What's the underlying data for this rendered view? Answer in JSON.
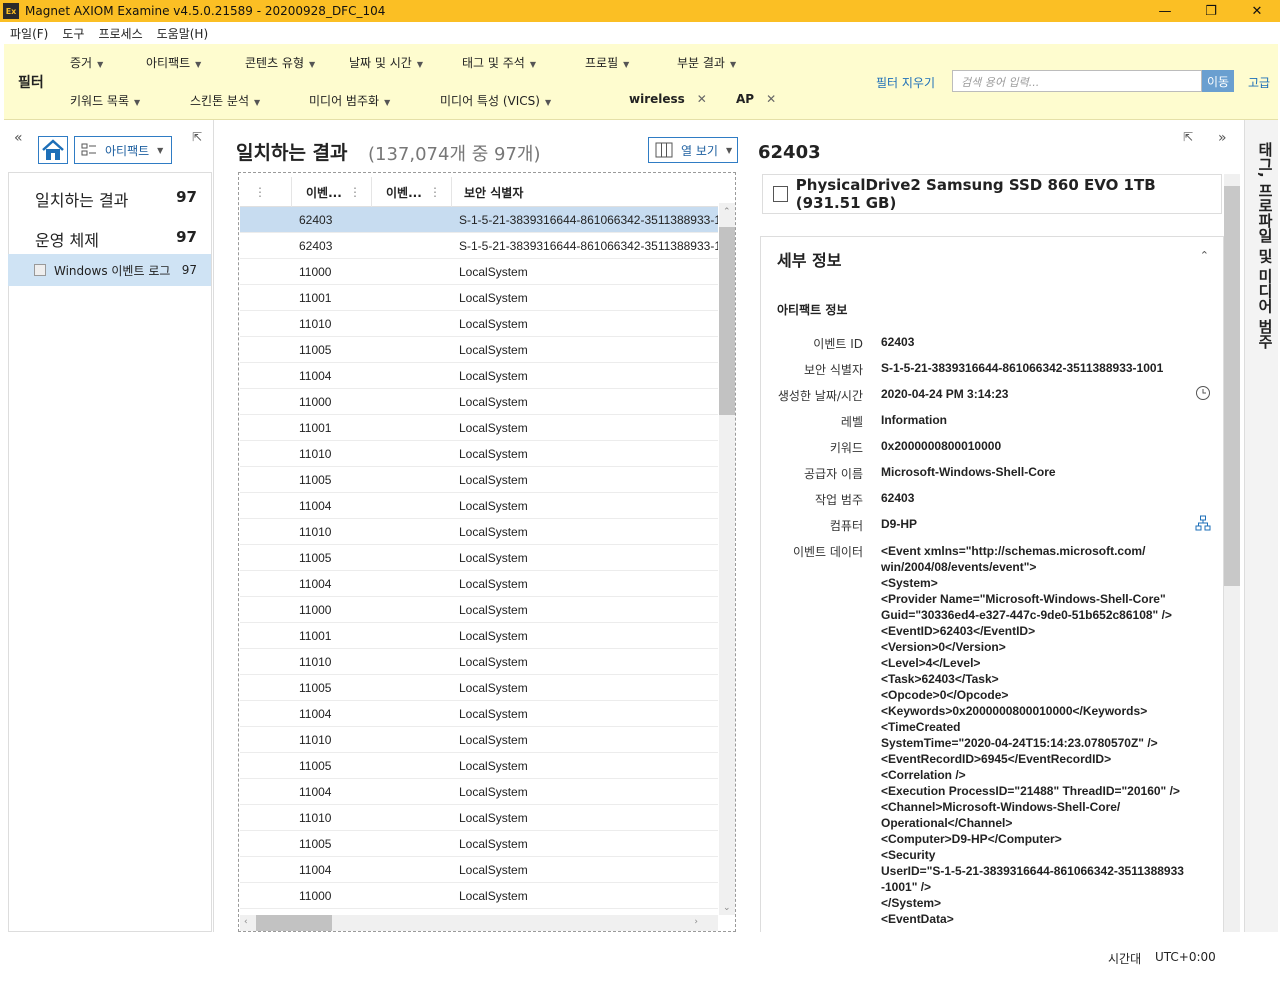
{
  "window": {
    "title": "Magnet AXIOM Examine v4.5.0.21589 - 20200928_DFC_104",
    "app_icon_text": "Ex",
    "minimize": "—",
    "restore": "❐",
    "close": "✕"
  },
  "menu": [
    "파일(F)",
    "도구",
    "프로세스",
    "도움말(H)"
  ],
  "filter": {
    "label": "필터",
    "row1": [
      "증거",
      "아티팩트",
      "콘텐츠 유형",
      "날짜 및 시간",
      "태그 및 주석",
      "프로필",
      "부분 결과"
    ],
    "row2": [
      "키워드 목록",
      "스킨톤 분석",
      "미디어 범주화",
      "미디어 특성 (VICS)"
    ],
    "active_filters": [
      "wireless",
      "AP"
    ],
    "clear_label": "필터 지우기",
    "search_placeholder": "검색 용어 입력...",
    "go_label": "이동",
    "advanced_label": "고급"
  },
  "left": {
    "artifact_dropdown": "아티팩트",
    "nav": [
      {
        "label": "일치하는 결과",
        "count": "97"
      },
      {
        "label": "운영 체제",
        "count": "97"
      }
    ],
    "sub_item": {
      "label": "Windows 이벤트 로그",
      "count": "97"
    }
  },
  "results": {
    "title": "일치하는 결과",
    "subtitle": "(137,074개 중 97개)",
    "column_view": "열 보기",
    "columns": [
      "이벤...",
      "이벤...",
      "보안 식별자"
    ],
    "rows": [
      {
        "id": "62403",
        "sid": "S-1-5-21-3839316644-861066342-3511388933-1001",
        "selected": true
      },
      {
        "id": "62403",
        "sid": "S-1-5-21-3839316644-861066342-3511388933-1001"
      },
      {
        "id": "11000",
        "sid": "LocalSystem"
      },
      {
        "id": "11001",
        "sid": "LocalSystem"
      },
      {
        "id": "11010",
        "sid": "LocalSystem"
      },
      {
        "id": "11005",
        "sid": "LocalSystem"
      },
      {
        "id": "11004",
        "sid": "LocalSystem"
      },
      {
        "id": "11000",
        "sid": "LocalSystem"
      },
      {
        "id": "11001",
        "sid": "LocalSystem"
      },
      {
        "id": "11010",
        "sid": "LocalSystem"
      },
      {
        "id": "11005",
        "sid": "LocalSystem"
      },
      {
        "id": "11004",
        "sid": "LocalSystem"
      },
      {
        "id": "11010",
        "sid": "LocalSystem"
      },
      {
        "id": "11005",
        "sid": "LocalSystem"
      },
      {
        "id": "11004",
        "sid": "LocalSystem"
      },
      {
        "id": "11000",
        "sid": "LocalSystem"
      },
      {
        "id": "11001",
        "sid": "LocalSystem"
      },
      {
        "id": "11010",
        "sid": "LocalSystem"
      },
      {
        "id": "11005",
        "sid": "LocalSystem"
      },
      {
        "id": "11004",
        "sid": "LocalSystem"
      },
      {
        "id": "11010",
        "sid": "LocalSystem"
      },
      {
        "id": "11005",
        "sid": "LocalSystem"
      },
      {
        "id": "11004",
        "sid": "LocalSystem"
      },
      {
        "id": "11010",
        "sid": "LocalSystem"
      },
      {
        "id": "11005",
        "sid": "LocalSystem"
      },
      {
        "id": "11004",
        "sid": "LocalSystem"
      },
      {
        "id": "11000",
        "sid": "LocalSystem"
      }
    ]
  },
  "detail": {
    "title": "62403",
    "source": "PhysicalDrive2 Samsung SSD 860 EVO 1TB (931.51 GB)",
    "section_title": "세부 정보",
    "group_label": "아티팩트 정보",
    "props": [
      {
        "label": "이벤트 ID",
        "value": "62403"
      },
      {
        "label": "보안 식별자",
        "value": "S-1-5-21-3839316644-861066342-3511388933-1001"
      },
      {
        "label": "생성한 날짜/시간",
        "value": "2020-04-24 PM 3:14:23"
      },
      {
        "label": "레벨",
        "value": "Information"
      },
      {
        "label": "키워드",
        "value": "0x2000000800010000"
      },
      {
        "label": "공급자 이름",
        "value": "Microsoft-Windows-Shell-Core"
      },
      {
        "label": "작업 범주",
        "value": "62403"
      },
      {
        "label": "컴퓨터",
        "value": "D9-HP"
      }
    ],
    "event_data_label": "이벤트 데이터",
    "event_data": "<Event xmlns=\"http://schemas.microsoft.com/\nwin/2004/08/events/event\">\n<System>\n<Provider Name=\"Microsoft-Windows-Shell-Core\"\nGuid=\"30336ed4-e327-447c-9de0-51b652c86108\" />\n<EventID>62403</EventID>\n<Version>0</Version>\n<Level>4</Level>\n<Task>62403</Task>\n<Opcode>0</Opcode>\n<Keywords>0x2000000800010000</Keywords>\n<TimeCreated\nSystemTime=\"2020-04-24T15:14:23.0780570Z\" />\n<EventRecordID>6945</EventRecordID>\n<Correlation />\n<Execution ProcessID=\"21488\" ThreadID=\"20160\" />\n<Channel>Microsoft-Windows-Shell-Core/\nOperational</Channel>\n<Computer>D9-HP</Computer>\n<Security\nUserID=\"S-1-5-21-3839316644-861066342-3511388933\n-1001\" />\n</System>\n<EventData>"
  },
  "side_tab": "태그, 프로파일 및 미디어 범주",
  "status": {
    "label": "시간대",
    "value": "UTC+0:00"
  }
}
